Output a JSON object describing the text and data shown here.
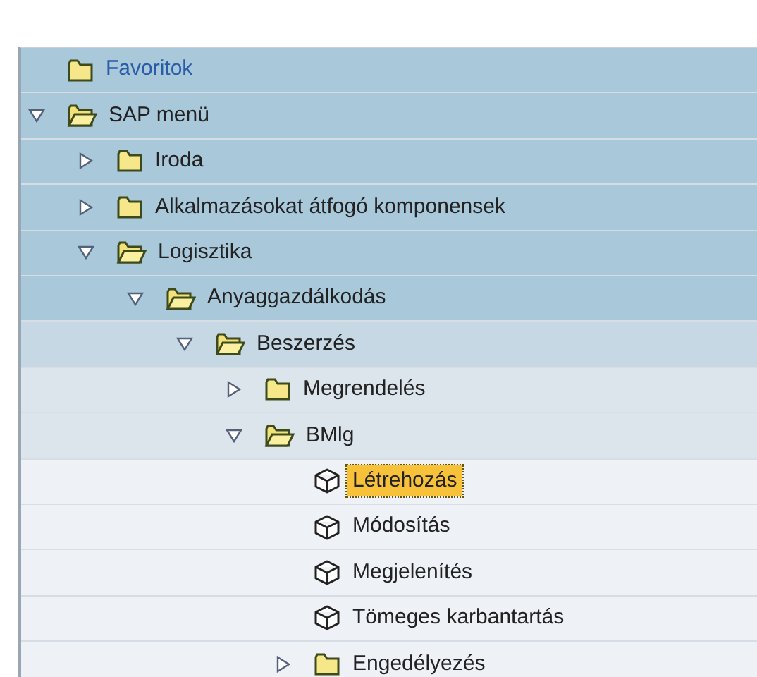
{
  "tree": [
    {
      "label": "Favoritok",
      "kind": "favorites"
    },
    {
      "label": "SAP menü",
      "kind": "folder",
      "expanded": true,
      "children": [
        {
          "label": "Iroda",
          "kind": "folder",
          "expanded": false
        },
        {
          "label": "Alkalmazásokat átfogó komponensek",
          "kind": "folder",
          "expanded": false
        },
        {
          "label": "Logisztika",
          "kind": "folder",
          "expanded": true,
          "children": [
            {
              "label": "Anyaggazdálkodás",
              "kind": "folder",
              "expanded": true,
              "children": [
                {
                  "label": "Beszerzés",
                  "kind": "folder",
                  "expanded": true,
                  "children": [
                    {
                      "label": "Megrendelés",
                      "kind": "folder",
                      "expanded": false
                    },
                    {
                      "label": "BMlg",
                      "kind": "folder",
                      "expanded": true,
                      "children": [
                        {
                          "label": "Létrehozás",
                          "kind": "transaction",
                          "selected": true
                        },
                        {
                          "label": "Módosítás",
                          "kind": "transaction",
                          "selected": false
                        },
                        {
                          "label": "Megjelenítés",
                          "kind": "transaction",
                          "selected": false
                        },
                        {
                          "label": "Tömeges karbantartás",
                          "kind": "transaction",
                          "selected": false
                        },
                        {
                          "label": "Engedélyezés",
                          "kind": "folder",
                          "expanded": false
                        }
                      ]
                    }
                  ]
                }
              ]
            }
          ]
        }
      ]
    }
  ]
}
